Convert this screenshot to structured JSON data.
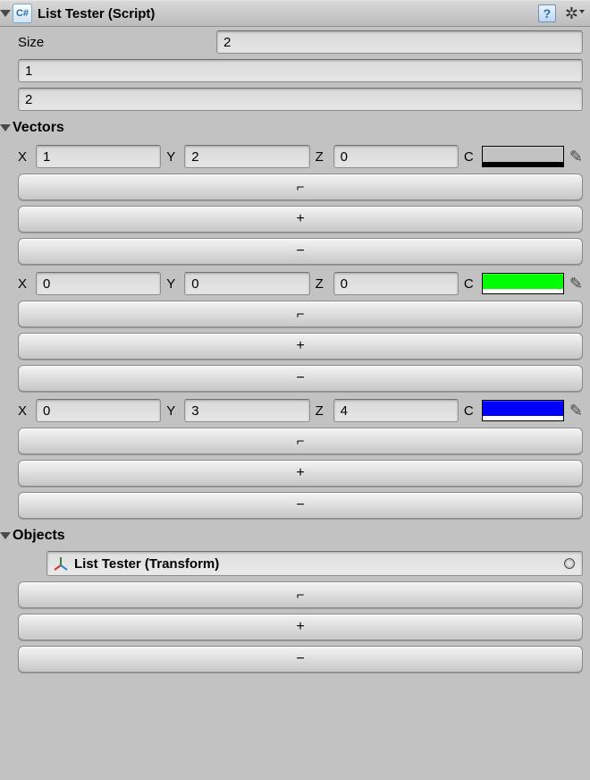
{
  "header": {
    "title": "List Tester (Script)"
  },
  "size": {
    "label": "Size",
    "value": "2",
    "items": [
      "1",
      "2"
    ]
  },
  "vectors_section": {
    "title": "Vectors",
    "axis_labels": {
      "x": "X",
      "y": "Y",
      "z": "Z",
      "c": "C"
    },
    "items": [
      {
        "x": "1",
        "y": "2",
        "z": "0",
        "color": "#ff0000",
        "alpha_bar": "#000000"
      },
      {
        "x": "0",
        "y": "0",
        "z": "0",
        "color": "#00ff00",
        "alpha_bar": "#ffffff"
      },
      {
        "x": "0",
        "y": "3",
        "z": "4",
        "color": "#0000ff",
        "alpha_bar": "#ffffff"
      }
    ],
    "buttons": {
      "duplicate": "⌐",
      "add": "+",
      "remove": "−"
    }
  },
  "objects_section": {
    "title": "Objects",
    "items": [
      {
        "label": "List Tester (Transform)"
      }
    ],
    "buttons": {
      "duplicate": "⌐",
      "add": "+",
      "remove": "−"
    }
  }
}
